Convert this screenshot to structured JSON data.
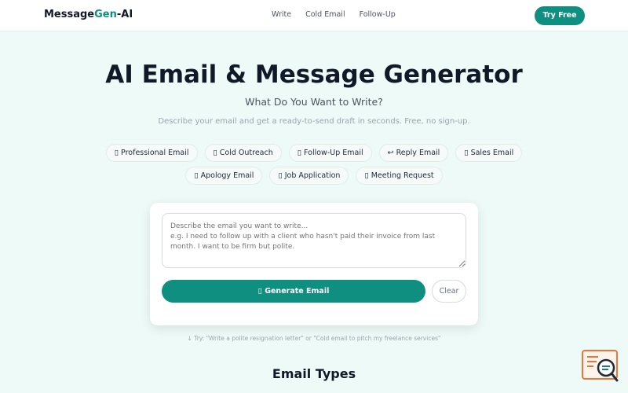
{
  "header": {
    "logo_part1": "Message",
    "logo_part2": "Gen",
    "logo_part3": "-AI",
    "nav": [
      "Write",
      "Cold Email",
      "Follow-Up"
    ],
    "cta": "Try Free"
  },
  "hero": {
    "title": "AI Email & Message Generator",
    "subtitle": "What Do You Want to Write?",
    "description": "Describe your email and get a ready-to-send draft in seconds. Free, no sign-up."
  },
  "chips_row1": [
    {
      "icon": "▯",
      "label": "Professional Email"
    },
    {
      "icon": "▯",
      "label": "Cold Outreach"
    },
    {
      "icon": "▯",
      "label": "Follow-Up Email"
    },
    {
      "icon": "↩",
      "label": "Reply Email"
    },
    {
      "icon": "▯",
      "label": "Sales Email"
    }
  ],
  "chips_row2": [
    {
      "icon": "▯",
      "label": "Apology Email"
    },
    {
      "icon": "▯",
      "label": "Job Application"
    },
    {
      "icon": "▯",
      "label": "Meeting Request"
    }
  ],
  "composer": {
    "placeholder": "Describe the email you want to write...\ne.g. I need to follow up with a client who hasn't paid their invoice from last month. I want to be firm but polite.",
    "generate_icon": "▯",
    "generate_label": "Generate Email",
    "clear_label": "Clear"
  },
  "hint": "↓ Try: \"Write a polite resignation letter\" or \"Cold email to pitch my freelance services\"",
  "section_title": "Email Types",
  "colors": {
    "accent": "#0f8f7f",
    "background": "#eefaf8",
    "widget": "#e8763a"
  },
  "icons": {
    "widget": "chat-search-widget-icon"
  }
}
